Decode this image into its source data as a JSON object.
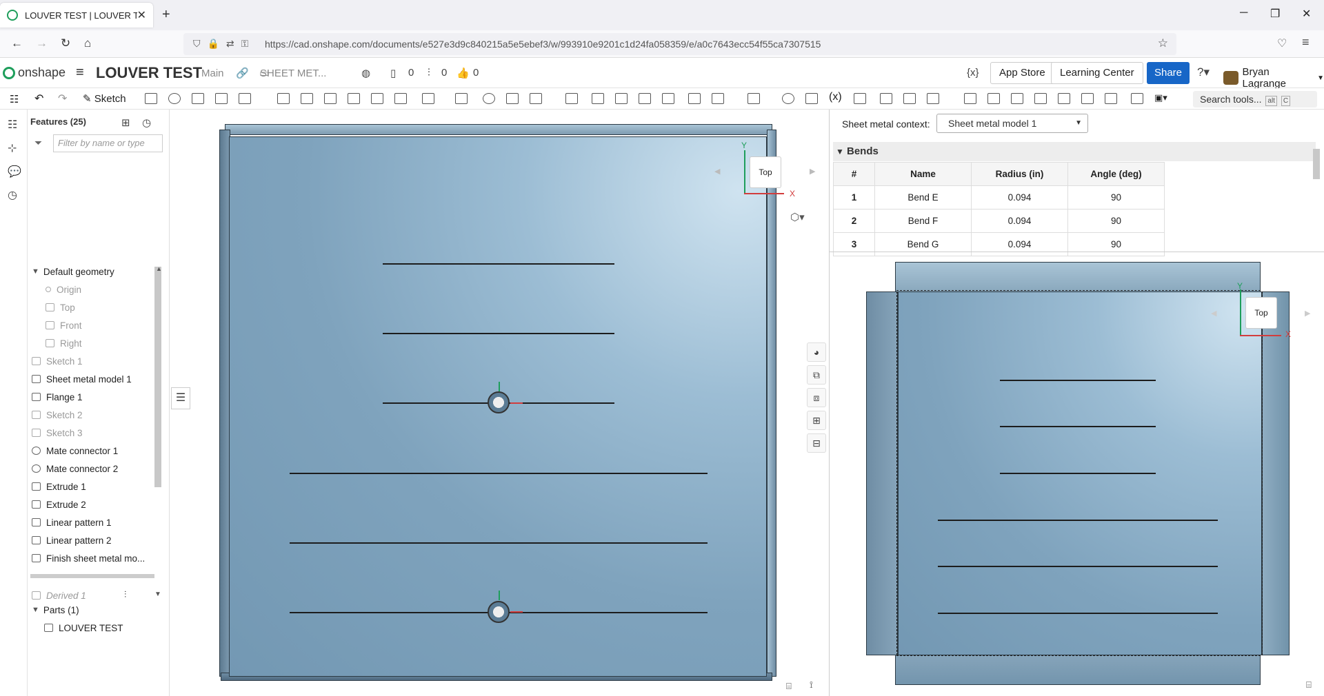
{
  "browser": {
    "tab_title": "LOUVER TEST | LOUVER TEST",
    "url": "https://cad.onshape.com/documents/e527e3d9c840215a5e5ebef3/w/993910e9201c1d24fa058359/e/a0c7643ecc54f55ca7307515"
  },
  "header": {
    "brand": "onshape",
    "doc_title": "LOUVER TEST",
    "branch": "Main",
    "breadcrumb": "SHEET MET...",
    "counter_versions": "0",
    "counter_comments": "0",
    "counter_likes": "0",
    "variables_label": "{x}",
    "app_store": "App Store",
    "learning_center": "Learning Center",
    "share": "Share",
    "user_name": "Bryan Lagrange"
  },
  "toolbar": {
    "sketch": "Sketch",
    "search_label": "Search tools...",
    "search_kbd_1": "alt",
    "search_kbd_2": "C"
  },
  "features": {
    "title": "Features (25)",
    "filter_placeholder": "Filter by name or type",
    "default_geometry": "Default geometry",
    "items": [
      {
        "label": "Origin"
      },
      {
        "label": "Top"
      },
      {
        "label": "Front"
      },
      {
        "label": "Right"
      },
      {
        "label": "Sketch 1"
      },
      {
        "label": "Sheet metal model 1"
      },
      {
        "label": "Flange 1"
      },
      {
        "label": "Sketch 2"
      },
      {
        "label": "Sketch 3"
      },
      {
        "label": "Mate connector 1"
      },
      {
        "label": "Mate connector 2"
      },
      {
        "label": "Extrude 1"
      },
      {
        "label": "Extrude 2"
      },
      {
        "label": "Linear pattern 1"
      },
      {
        "label": "Linear pattern 2"
      },
      {
        "label": "Finish sheet metal mo..."
      },
      {
        "label": "Derived 1"
      }
    ],
    "parts_header": "Parts (1)",
    "part_name": "LOUVER TEST"
  },
  "viewport": {
    "view_cube_label": "Top",
    "axis_y": "Y",
    "axis_x": "X"
  },
  "right_panel": {
    "context_label": "Sheet metal context:",
    "context_value": "Sheet metal model 1",
    "bends_title": "Bends",
    "columns": [
      "#",
      "Name",
      "Radius (in)",
      "Angle (deg)"
    ],
    "rows": [
      {
        "num": "1",
        "name": "Bend E",
        "radius": "0.094",
        "angle": "90"
      },
      {
        "num": "2",
        "name": "Bend F",
        "radius": "0.094",
        "angle": "90"
      },
      {
        "num": "3",
        "name": "Bend G",
        "radius": "0.094",
        "angle": "90"
      }
    ],
    "flat_view_label": "Top",
    "flat_axis_y": "Y",
    "flat_axis_x": "X"
  }
}
